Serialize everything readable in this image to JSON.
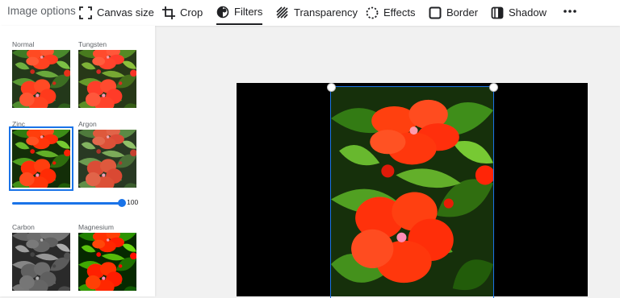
{
  "toolbar": {
    "title": "Image options",
    "items": [
      {
        "label": "Canvas size",
        "icon": "expand-icon"
      },
      {
        "label": "Crop",
        "icon": "crop-icon"
      },
      {
        "label": "Filters",
        "icon": "filters-icon",
        "active": true
      },
      {
        "label": "Transparency",
        "icon": "transparency-icon"
      },
      {
        "label": "Effects",
        "icon": "effects-icon"
      },
      {
        "label": "Border",
        "icon": "border-icon"
      },
      {
        "label": "Shadow",
        "icon": "shadow-icon"
      }
    ],
    "more_icon": "more-horizontal-icon"
  },
  "filters": {
    "items": [
      {
        "label": "Normal"
      },
      {
        "label": "Tungsten"
      },
      {
        "label": "Zinc",
        "selected": true
      },
      {
        "label": "Argon"
      },
      {
        "label": "Carbon"
      },
      {
        "label": "Magnesium"
      }
    ],
    "intensity": "100"
  },
  "colors": {
    "accent": "#1a73e8",
    "flower": "#ff3b1f",
    "leaf": "#2f5e1c"
  }
}
